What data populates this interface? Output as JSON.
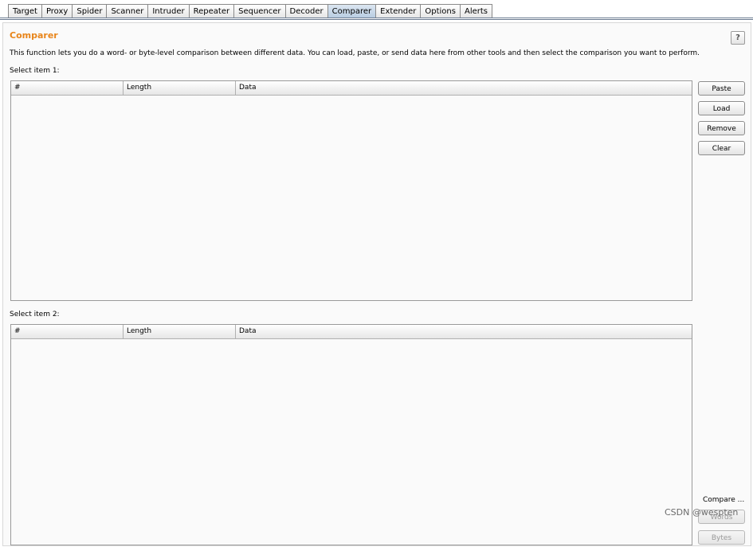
{
  "tabs": [
    "Target",
    "Proxy",
    "Spider",
    "Scanner",
    "Intruder",
    "Repeater",
    "Sequencer",
    "Decoder",
    "Comparer",
    "Extender",
    "Options",
    "Alerts"
  ],
  "active_tab": "Comparer",
  "panel": {
    "title": "Comparer",
    "help": "?",
    "description": "This function lets you do a word- or byte-level comparison between different data. You can load, paste, or send data here from other tools and then select the comparison you want to perform."
  },
  "item1": {
    "label": "Select item 1:",
    "columns": [
      "#",
      "Length",
      "Data"
    ]
  },
  "item2": {
    "label": "Select item 2:",
    "columns": [
      "#",
      "Length",
      "Data"
    ]
  },
  "buttons": {
    "paste": "Paste",
    "load": "Load",
    "remove": "Remove",
    "clear": "Clear"
  },
  "compare": {
    "label": "Compare ...",
    "words": "Words",
    "bytes": "Bytes"
  },
  "watermark": "CSDN @wespten",
  "colors": {
    "title": "#e8851a",
    "active_tab": "#c5d6e8"
  }
}
